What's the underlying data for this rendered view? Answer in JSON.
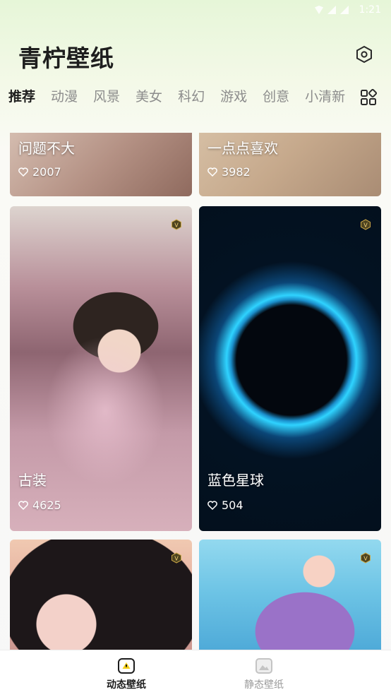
{
  "status_bar": {
    "time": "1:21"
  },
  "header": {
    "title": "青柠壁纸",
    "settings_icon": "hexagon-settings-icon"
  },
  "tabs": [
    {
      "label": "推荐",
      "active": true
    },
    {
      "label": "动漫"
    },
    {
      "label": "风景"
    },
    {
      "label": "美女"
    },
    {
      "label": "科幻"
    },
    {
      "label": "游戏"
    },
    {
      "label": "创意"
    },
    {
      "label": "小清新"
    }
  ],
  "grid_icon": "category-grid-icon",
  "cards": [
    {
      "title": "问题不大",
      "likes": "2007",
      "vip": false
    },
    {
      "title": "一点点喜欢",
      "likes": "3982",
      "vip": false
    },
    {
      "title": "古装",
      "likes": "4625",
      "vip": true
    },
    {
      "title": "蓝色星球",
      "likes": "504",
      "vip": true
    },
    {
      "title": "",
      "likes": "",
      "vip": true
    },
    {
      "title": "",
      "likes": "",
      "vip": true
    }
  ],
  "bottom_nav": {
    "dynamic_label": "动态壁纸",
    "static_label": "静态壁纸"
  },
  "colors": {
    "accent": "#f4cf1a",
    "vip_badge": "#5a4a1a",
    "text_dark": "#1f1f1f"
  }
}
